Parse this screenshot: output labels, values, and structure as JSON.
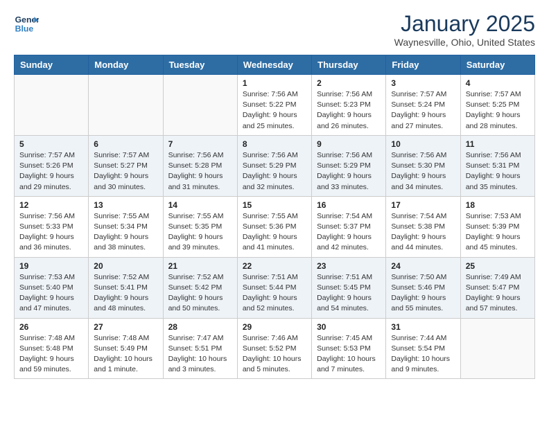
{
  "header": {
    "logo_line1": "General",
    "logo_line2": "Blue",
    "month": "January 2025",
    "location": "Waynesville, Ohio, United States"
  },
  "days_of_week": [
    "Sunday",
    "Monday",
    "Tuesday",
    "Wednesday",
    "Thursday",
    "Friday",
    "Saturday"
  ],
  "weeks": [
    [
      {
        "day": "",
        "info": ""
      },
      {
        "day": "",
        "info": ""
      },
      {
        "day": "",
        "info": ""
      },
      {
        "day": "1",
        "info": "Sunrise: 7:56 AM\nSunset: 5:22 PM\nDaylight: 9 hours\nand 25 minutes."
      },
      {
        "day": "2",
        "info": "Sunrise: 7:56 AM\nSunset: 5:23 PM\nDaylight: 9 hours\nand 26 minutes."
      },
      {
        "day": "3",
        "info": "Sunrise: 7:57 AM\nSunset: 5:24 PM\nDaylight: 9 hours\nand 27 minutes."
      },
      {
        "day": "4",
        "info": "Sunrise: 7:57 AM\nSunset: 5:25 PM\nDaylight: 9 hours\nand 28 minutes."
      }
    ],
    [
      {
        "day": "5",
        "info": "Sunrise: 7:57 AM\nSunset: 5:26 PM\nDaylight: 9 hours\nand 29 minutes."
      },
      {
        "day": "6",
        "info": "Sunrise: 7:57 AM\nSunset: 5:27 PM\nDaylight: 9 hours\nand 30 minutes."
      },
      {
        "day": "7",
        "info": "Sunrise: 7:56 AM\nSunset: 5:28 PM\nDaylight: 9 hours\nand 31 minutes."
      },
      {
        "day": "8",
        "info": "Sunrise: 7:56 AM\nSunset: 5:29 PM\nDaylight: 9 hours\nand 32 minutes."
      },
      {
        "day": "9",
        "info": "Sunrise: 7:56 AM\nSunset: 5:29 PM\nDaylight: 9 hours\nand 33 minutes."
      },
      {
        "day": "10",
        "info": "Sunrise: 7:56 AM\nSunset: 5:30 PM\nDaylight: 9 hours\nand 34 minutes."
      },
      {
        "day": "11",
        "info": "Sunrise: 7:56 AM\nSunset: 5:31 PM\nDaylight: 9 hours\nand 35 minutes."
      }
    ],
    [
      {
        "day": "12",
        "info": "Sunrise: 7:56 AM\nSunset: 5:33 PM\nDaylight: 9 hours\nand 36 minutes."
      },
      {
        "day": "13",
        "info": "Sunrise: 7:55 AM\nSunset: 5:34 PM\nDaylight: 9 hours\nand 38 minutes."
      },
      {
        "day": "14",
        "info": "Sunrise: 7:55 AM\nSunset: 5:35 PM\nDaylight: 9 hours\nand 39 minutes."
      },
      {
        "day": "15",
        "info": "Sunrise: 7:55 AM\nSunset: 5:36 PM\nDaylight: 9 hours\nand 41 minutes."
      },
      {
        "day": "16",
        "info": "Sunrise: 7:54 AM\nSunset: 5:37 PM\nDaylight: 9 hours\nand 42 minutes."
      },
      {
        "day": "17",
        "info": "Sunrise: 7:54 AM\nSunset: 5:38 PM\nDaylight: 9 hours\nand 44 minutes."
      },
      {
        "day": "18",
        "info": "Sunrise: 7:53 AM\nSunset: 5:39 PM\nDaylight: 9 hours\nand 45 minutes."
      }
    ],
    [
      {
        "day": "19",
        "info": "Sunrise: 7:53 AM\nSunset: 5:40 PM\nDaylight: 9 hours\nand 47 minutes."
      },
      {
        "day": "20",
        "info": "Sunrise: 7:52 AM\nSunset: 5:41 PM\nDaylight: 9 hours\nand 48 minutes."
      },
      {
        "day": "21",
        "info": "Sunrise: 7:52 AM\nSunset: 5:42 PM\nDaylight: 9 hours\nand 50 minutes."
      },
      {
        "day": "22",
        "info": "Sunrise: 7:51 AM\nSunset: 5:44 PM\nDaylight: 9 hours\nand 52 minutes."
      },
      {
        "day": "23",
        "info": "Sunrise: 7:51 AM\nSunset: 5:45 PM\nDaylight: 9 hours\nand 54 minutes."
      },
      {
        "day": "24",
        "info": "Sunrise: 7:50 AM\nSunset: 5:46 PM\nDaylight: 9 hours\nand 55 minutes."
      },
      {
        "day": "25",
        "info": "Sunrise: 7:49 AM\nSunset: 5:47 PM\nDaylight: 9 hours\nand 57 minutes."
      }
    ],
    [
      {
        "day": "26",
        "info": "Sunrise: 7:48 AM\nSunset: 5:48 PM\nDaylight: 9 hours\nand 59 minutes."
      },
      {
        "day": "27",
        "info": "Sunrise: 7:48 AM\nSunset: 5:49 PM\nDaylight: 10 hours\nand 1 minute."
      },
      {
        "day": "28",
        "info": "Sunrise: 7:47 AM\nSunset: 5:51 PM\nDaylight: 10 hours\nand 3 minutes."
      },
      {
        "day": "29",
        "info": "Sunrise: 7:46 AM\nSunset: 5:52 PM\nDaylight: 10 hours\nand 5 minutes."
      },
      {
        "day": "30",
        "info": "Sunrise: 7:45 AM\nSunset: 5:53 PM\nDaylight: 10 hours\nand 7 minutes."
      },
      {
        "day": "31",
        "info": "Sunrise: 7:44 AM\nSunset: 5:54 PM\nDaylight: 10 hours\nand 9 minutes."
      },
      {
        "day": "",
        "info": ""
      }
    ]
  ]
}
